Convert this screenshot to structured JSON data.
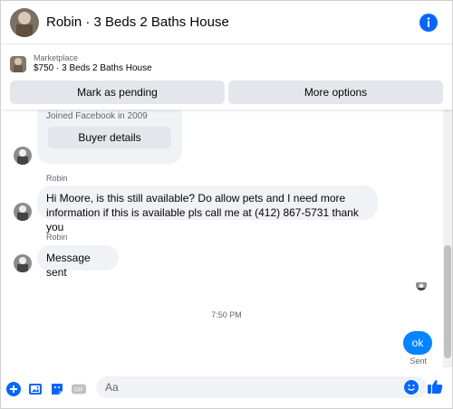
{
  "header": {
    "title": "Robin · 3 Beds 2 Baths House",
    "info_icon": "info-icon",
    "accent": "#0866ff"
  },
  "marketplace": {
    "label": "Marketplace",
    "listing": "$750 · 3 Beds 2 Baths House",
    "buttons": {
      "mark_pending": "Mark as pending",
      "more_options": "More options"
    }
  },
  "thread": {
    "card": {
      "joined": "Joined Facebook in 2009",
      "buyer_details": "Buyer details"
    },
    "messages": [
      {
        "sender": "Robin",
        "text": "Hi Moore, is this still available? Do allow pets and I need more information if this is available pls call me at (412) 867-5731 thank you"
      },
      {
        "sender": "Robin",
        "text": "Message sent"
      }
    ],
    "timestamp": "7:50 PM",
    "outgoing": {
      "text": "ok",
      "status": "Sent"
    }
  },
  "composer": {
    "placeholder": "Aa",
    "icons": [
      "add-icon",
      "photo-icon",
      "sticker-icon",
      "gif-icon",
      "emoji-icon",
      "like-icon"
    ],
    "gif_label": "GIF"
  }
}
